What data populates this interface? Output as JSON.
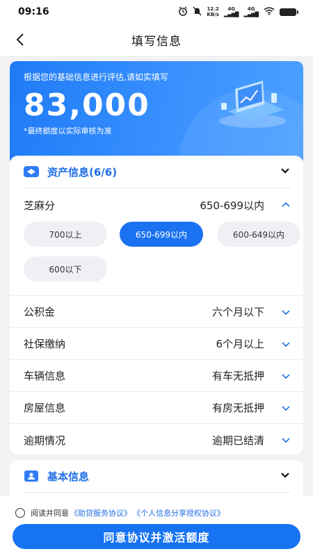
{
  "status_bar": {
    "time": "09:16",
    "network_speed_top": "12.2",
    "network_speed_unit": "KB/s",
    "signal1": "4G",
    "signal2": "4G"
  },
  "nav": {
    "title": "填写信息"
  },
  "hero": {
    "hint": "根据您的基础信息进行评估,请如实填写",
    "amount": "83,000",
    "note": "*最终额度以实际审核为准"
  },
  "asset_section": {
    "title": "资产信息(6/6)",
    "sesame": {
      "label": "芝麻分",
      "value": "650-699以内",
      "options": [
        "700以上",
        "650-699以内",
        "600-649以内",
        "600以下"
      ],
      "selected": "650-699以内"
    },
    "rows": [
      {
        "label": "公积金",
        "value": "六个月以下"
      },
      {
        "label": "社保缴纳",
        "value": "6个月以上"
      },
      {
        "label": "车辆信息",
        "value": "有车无抵押"
      },
      {
        "label": "房屋信息",
        "value": "有房无抵押"
      },
      {
        "label": "逾期情况",
        "value": "逾期已结清"
      }
    ]
  },
  "basic_section": {
    "title": "基本信息"
  },
  "footer": {
    "agree_text": "阅读并同意",
    "link1": "《助贷服务协议》",
    "link2": "《个人信息分享授权协议》",
    "cta": "同意协议并激活额度"
  },
  "colors": {
    "primary": "#1a72f0",
    "accent_text": "#1f6fe8"
  }
}
